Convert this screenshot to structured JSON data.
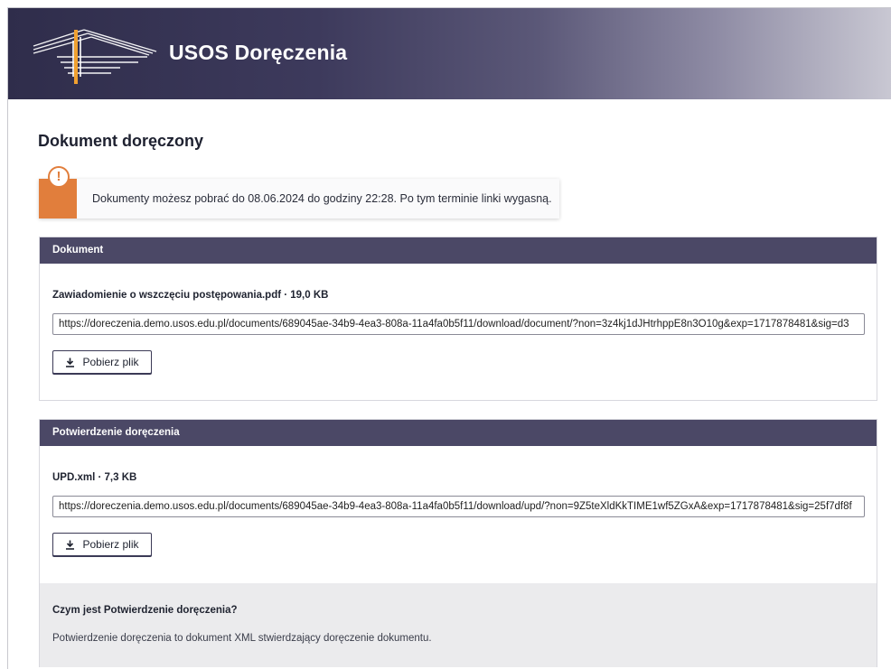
{
  "header": {
    "app_title": "USOS Doręczenia"
  },
  "page": {
    "title": "Dokument doręczony"
  },
  "alert": {
    "text": "Dokumenty możesz pobrać do 08.06.2024 do godziny 22:28. Po tym terminie linki wygasną.",
    "icon": "exclamation-icon",
    "color": "#e17e3c"
  },
  "document_panel": {
    "heading": "Dokument",
    "file_label": "Zawiadomienie o wszczęciu postępowania.pdf · 19,0 KB",
    "url": "https://doreczenia.demo.usos.edu.pl/documents/689045ae-34b9-4ea3-808a-11a4fa0b5f11/download/document/?non=3z4kj1dJHtrhppE8n3O10g&exp=1717878481&sig=d3",
    "button_label": "Pobierz plik"
  },
  "confirmation_panel": {
    "heading": "Potwierdzenie doręczenia",
    "file_label": "UPD.xml · 7,3 KB",
    "url": "https://doreczenia.demo.usos.edu.pl/documents/689045ae-34b9-4ea3-808a-11a4fa0b5f11/download/upd/?non=9Z5teXldKkTIME1wf5ZGxA&exp=1717878481&sig=25f7df8f",
    "button_label": "Pobierz plik",
    "info_title": "Czym jest Potwierdzenie doręczenia?",
    "info_text": "Potwierdzenie doręczenia to dokument XML stwierdzający doręczenie dokumentu."
  },
  "colors": {
    "header_dark": "#2f2d4b",
    "panel_head": "#4b4866",
    "accent_orange": "#e17e3c",
    "info_bg": "#ebebed"
  }
}
